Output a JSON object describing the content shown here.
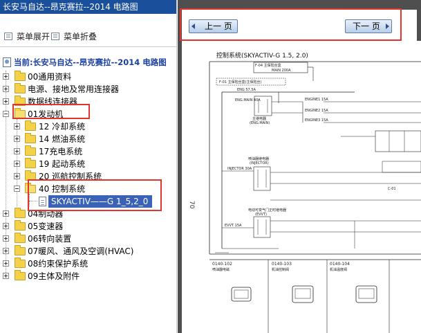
{
  "window": {
    "title": "长安马自达--昂克赛拉--2014 电路图"
  },
  "toolbar": {
    "expand_label": "菜单展开",
    "collapse_label": "菜单折叠"
  },
  "tree": {
    "root_label": "当前:长安马自达--昂克赛拉--2014 电路图",
    "items": [
      {
        "label": "00通用资料",
        "expanded": false
      },
      {
        "label": "电源、接地及常用连接器",
        "expanded": false
      },
      {
        "label": "数据线连接器",
        "expanded": false
      },
      {
        "label": "01发动机",
        "expanded": true
      },
      {
        "label": "12 冷却系统",
        "expanded": false
      },
      {
        "label": "14 燃油系统",
        "expanded": false
      },
      {
        "label": "17充电系统",
        "expanded": false
      },
      {
        "label": "19 起动系统",
        "expanded": false
      },
      {
        "label": "20 巡航控制系统",
        "expanded": false
      },
      {
        "label": "40 控制系统",
        "expanded": true
      },
      {
        "label": "SKYACTIV——G 1_5,2_0",
        "selected": true
      },
      {
        "label": "04制动器",
        "expanded": false
      },
      {
        "label": "05变速器",
        "expanded": false
      },
      {
        "label": "06转向装置",
        "expanded": false
      },
      {
        "label": "07暖风、通风及空调(HVAC)",
        "expanded": false
      },
      {
        "label": "08约束保护系统",
        "expanded": false
      },
      {
        "label": "09主体及附件",
        "expanded": false
      }
    ]
  },
  "navigation": {
    "prev_label": "上一 页",
    "next_label": "下一 页"
  },
  "document": {
    "page_number": "70",
    "diagram_title": "控制系统(SKYACTIV-G 1.5, 2.0)",
    "labels": {
      "f04": "F-04 主保险丝盒",
      "main": "MAIN 200A",
      "f01": "F-01 主保险丝盒(主保险丝)",
      "eng": "ENG 57.5A",
      "engmain": "ENG.MAIN 40A",
      "relay_main": "主继电器",
      "relay_main_en": "(ENG.MAIN)",
      "engine1": "ENGINE1 15A",
      "engine2": "ENGINE2 15A",
      "engine3": "ENGINE3 15A",
      "injector_fuse": "INJECTOR 30A",
      "injector_relay": "喷油器继电器",
      "injector_en": "(INJECTOR)",
      "evvt_fuse": "EVVT 15A",
      "evvt_relay": "电动可变气门正时继电器",
      "evvt_en": "(EVVT)",
      "c01": "C-01",
      "conn1_id": "0140-102",
      "conn1_name": "喷油器电磁",
      "conn2_id": "0140-103",
      "conn2_name": "机油控制阀",
      "conn3_id": "0140-104",
      "conn3_name": "机油温度阀"
    }
  }
}
